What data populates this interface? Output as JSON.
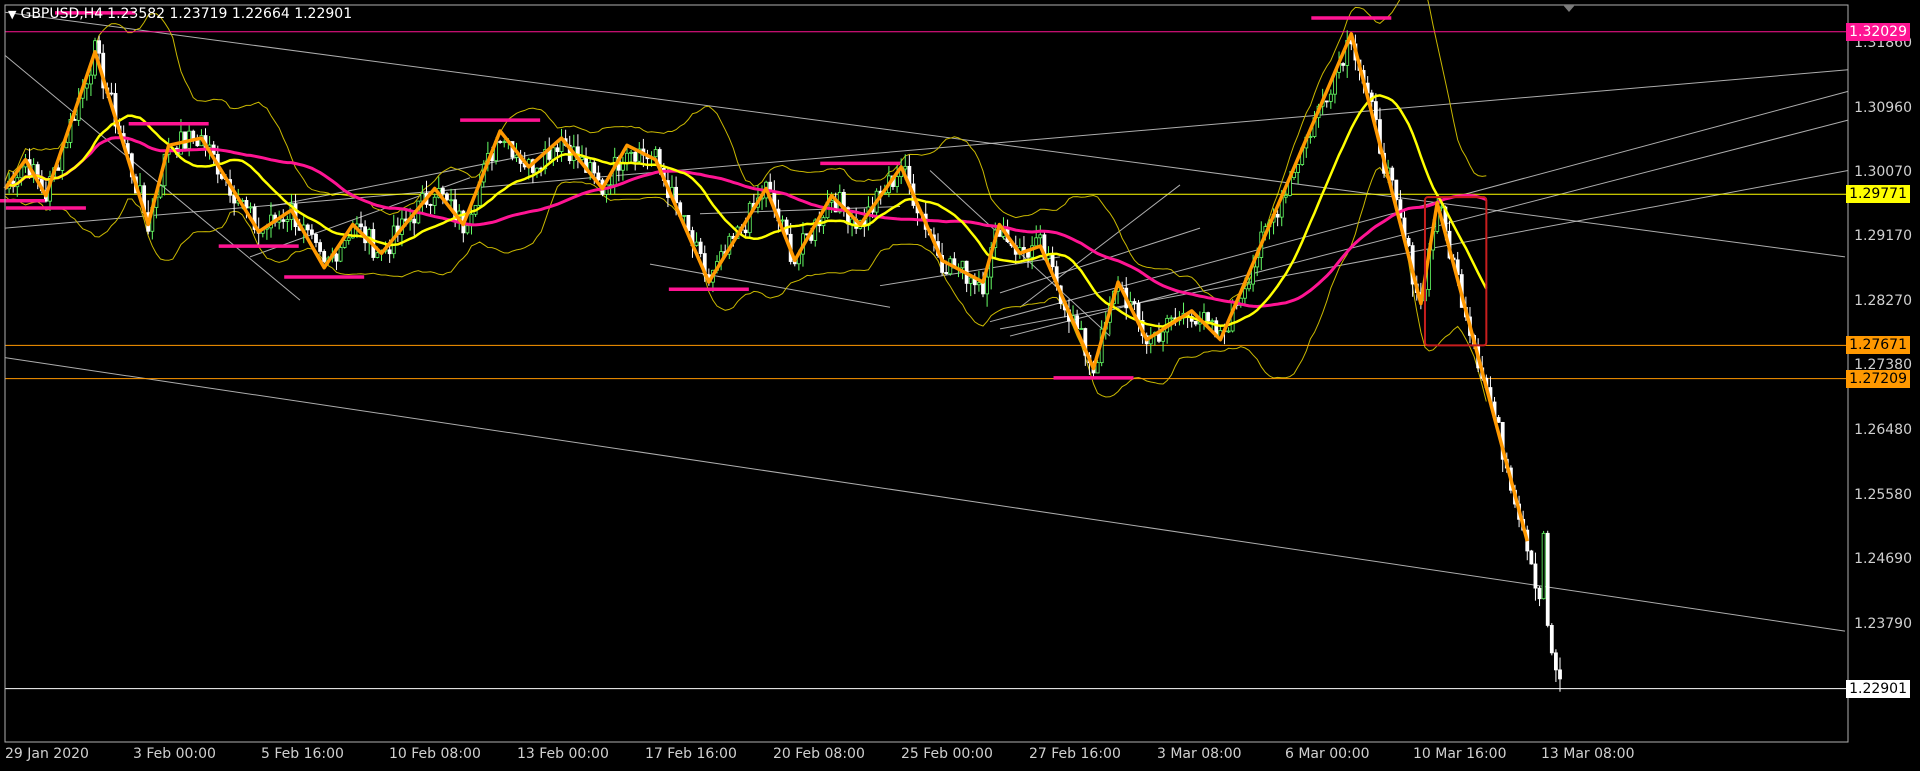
{
  "header": {
    "symbol": "GBPUSD,H4",
    "ohlc": "1.23582 1.23719 1.22664 1.22901"
  },
  "colors": {
    "background": "#000000",
    "frame": "#b0b0b0",
    "grid": "#2a2a2a",
    "candle_up": "#66ff66",
    "candle_down": "#ffffff",
    "zigzag": "#ff9800",
    "ma_fast": "#ffff00",
    "ma_slow": "#ff1493",
    "bollinger": "#c9b800",
    "hline_magenta": "#ff1493",
    "hline_yellow": "#ffff00",
    "hline_orange": "#ff9800",
    "trendline": "#cccccc",
    "box": "#c81e1e"
  },
  "chart_data": {
    "type": "candlestick",
    "symbol": "GBPUSD",
    "timeframe": "H4",
    "x_tick_labels": [
      "29 Jan 2020",
      "3 Feb 00:00",
      "5 Feb 16:00",
      "10 Feb 08:00",
      "13 Feb 00:00",
      "17 Feb 16:00",
      "20 Feb 08:00",
      "25 Feb 00:00",
      "27 Feb 16:00",
      "3 Mar 08:00",
      "6 Mar 00:00",
      "10 Mar 16:00",
      "13 Mar 08:00"
    ],
    "y_tick_labels": [
      "1.31860",
      "1.30960",
      "1.30070",
      "1.29170",
      "1.28270",
      "1.27380",
      "1.26480",
      "1.25580",
      "1.24690",
      "1.23790"
    ],
    "ylim": [
      1.2216,
      1.324
    ],
    "price_tags": [
      {
        "value": 1.32029,
        "label": "1.32029",
        "color": "#ff1493",
        "text_color": "#ffffff"
      },
      {
        "value": 1.29771,
        "label": "1.29771",
        "color": "#ffff00",
        "text_color": "#000000"
      },
      {
        "value": 1.27671,
        "label": "1.27671",
        "color": "#ff9800",
        "text_color": "#000000"
      },
      {
        "value": 1.27209,
        "label": "1.27209",
        "color": "#ff9800",
        "text_color": "#000000"
      },
      {
        "value": 1.22901,
        "label": "1.22901",
        "color": "#ffffff",
        "text_color": "#000000"
      }
    ],
    "zigzag_pivots": [
      {
        "x": 0,
        "y": 1.2985
      },
      {
        "x": 5,
        "y": 1.3025
      },
      {
        "x": 10,
        "y": 1.2975
      },
      {
        "x": 22,
        "y": 1.3175
      },
      {
        "x": 35,
        "y": 1.2935
      },
      {
        "x": 40,
        "y": 1.3045
      },
      {
        "x": 48,
        "y": 1.3055
      },
      {
        "x": 62,
        "y": 1.2925
      },
      {
        "x": 70,
        "y": 1.2955
      },
      {
        "x": 78,
        "y": 1.2875
      },
      {
        "x": 85,
        "y": 1.2935
      },
      {
        "x": 92,
        "y": 1.2895
      },
      {
        "x": 105,
        "y": 1.2985
      },
      {
        "x": 112,
        "y": 1.2935
      },
      {
        "x": 121,
        "y": 1.3065
      },
      {
        "x": 128,
        "y": 1.3015
      },
      {
        "x": 136,
        "y": 1.3055
      },
      {
        "x": 146,
        "y": 1.2985
      },
      {
        "x": 152,
        "y": 1.3045
      },
      {
        "x": 159,
        "y": 1.3025
      },
      {
        "x": 172,
        "y": 1.2855
      },
      {
        "x": 186,
        "y": 1.2985
      },
      {
        "x": 193,
        "y": 1.2885
      },
      {
        "x": 202,
        "y": 1.2975
      },
      {
        "x": 209,
        "y": 1.2935
      },
      {
        "x": 219,
        "y": 1.3015
      },
      {
        "x": 229,
        "y": 1.2885
      },
      {
        "x": 239,
        "y": 1.2855
      },
      {
        "x": 243,
        "y": 1.2935
      },
      {
        "x": 248,
        "y": 1.2895
      },
      {
        "x": 253,
        "y": 1.2905
      },
      {
        "x": 266,
        "y": 1.2735
      },
      {
        "x": 272,
        "y": 1.2855
      },
      {
        "x": 279,
        "y": 1.2775
      },
      {
        "x": 290,
        "y": 1.2815
      },
      {
        "x": 297,
        "y": 1.2775
      },
      {
        "x": 329,
        "y": 1.32
      },
      {
        "x": 346,
        "y": 1.2825
      },
      {
        "x": 350,
        "y": 1.2965
      },
      {
        "x": 372,
        "y": 1.2495
      }
    ],
    "box": {
      "x1": 347,
      "x2": 362,
      "y1": 1.2973,
      "y2": 1.2767
    },
    "series_note": ""
  }
}
